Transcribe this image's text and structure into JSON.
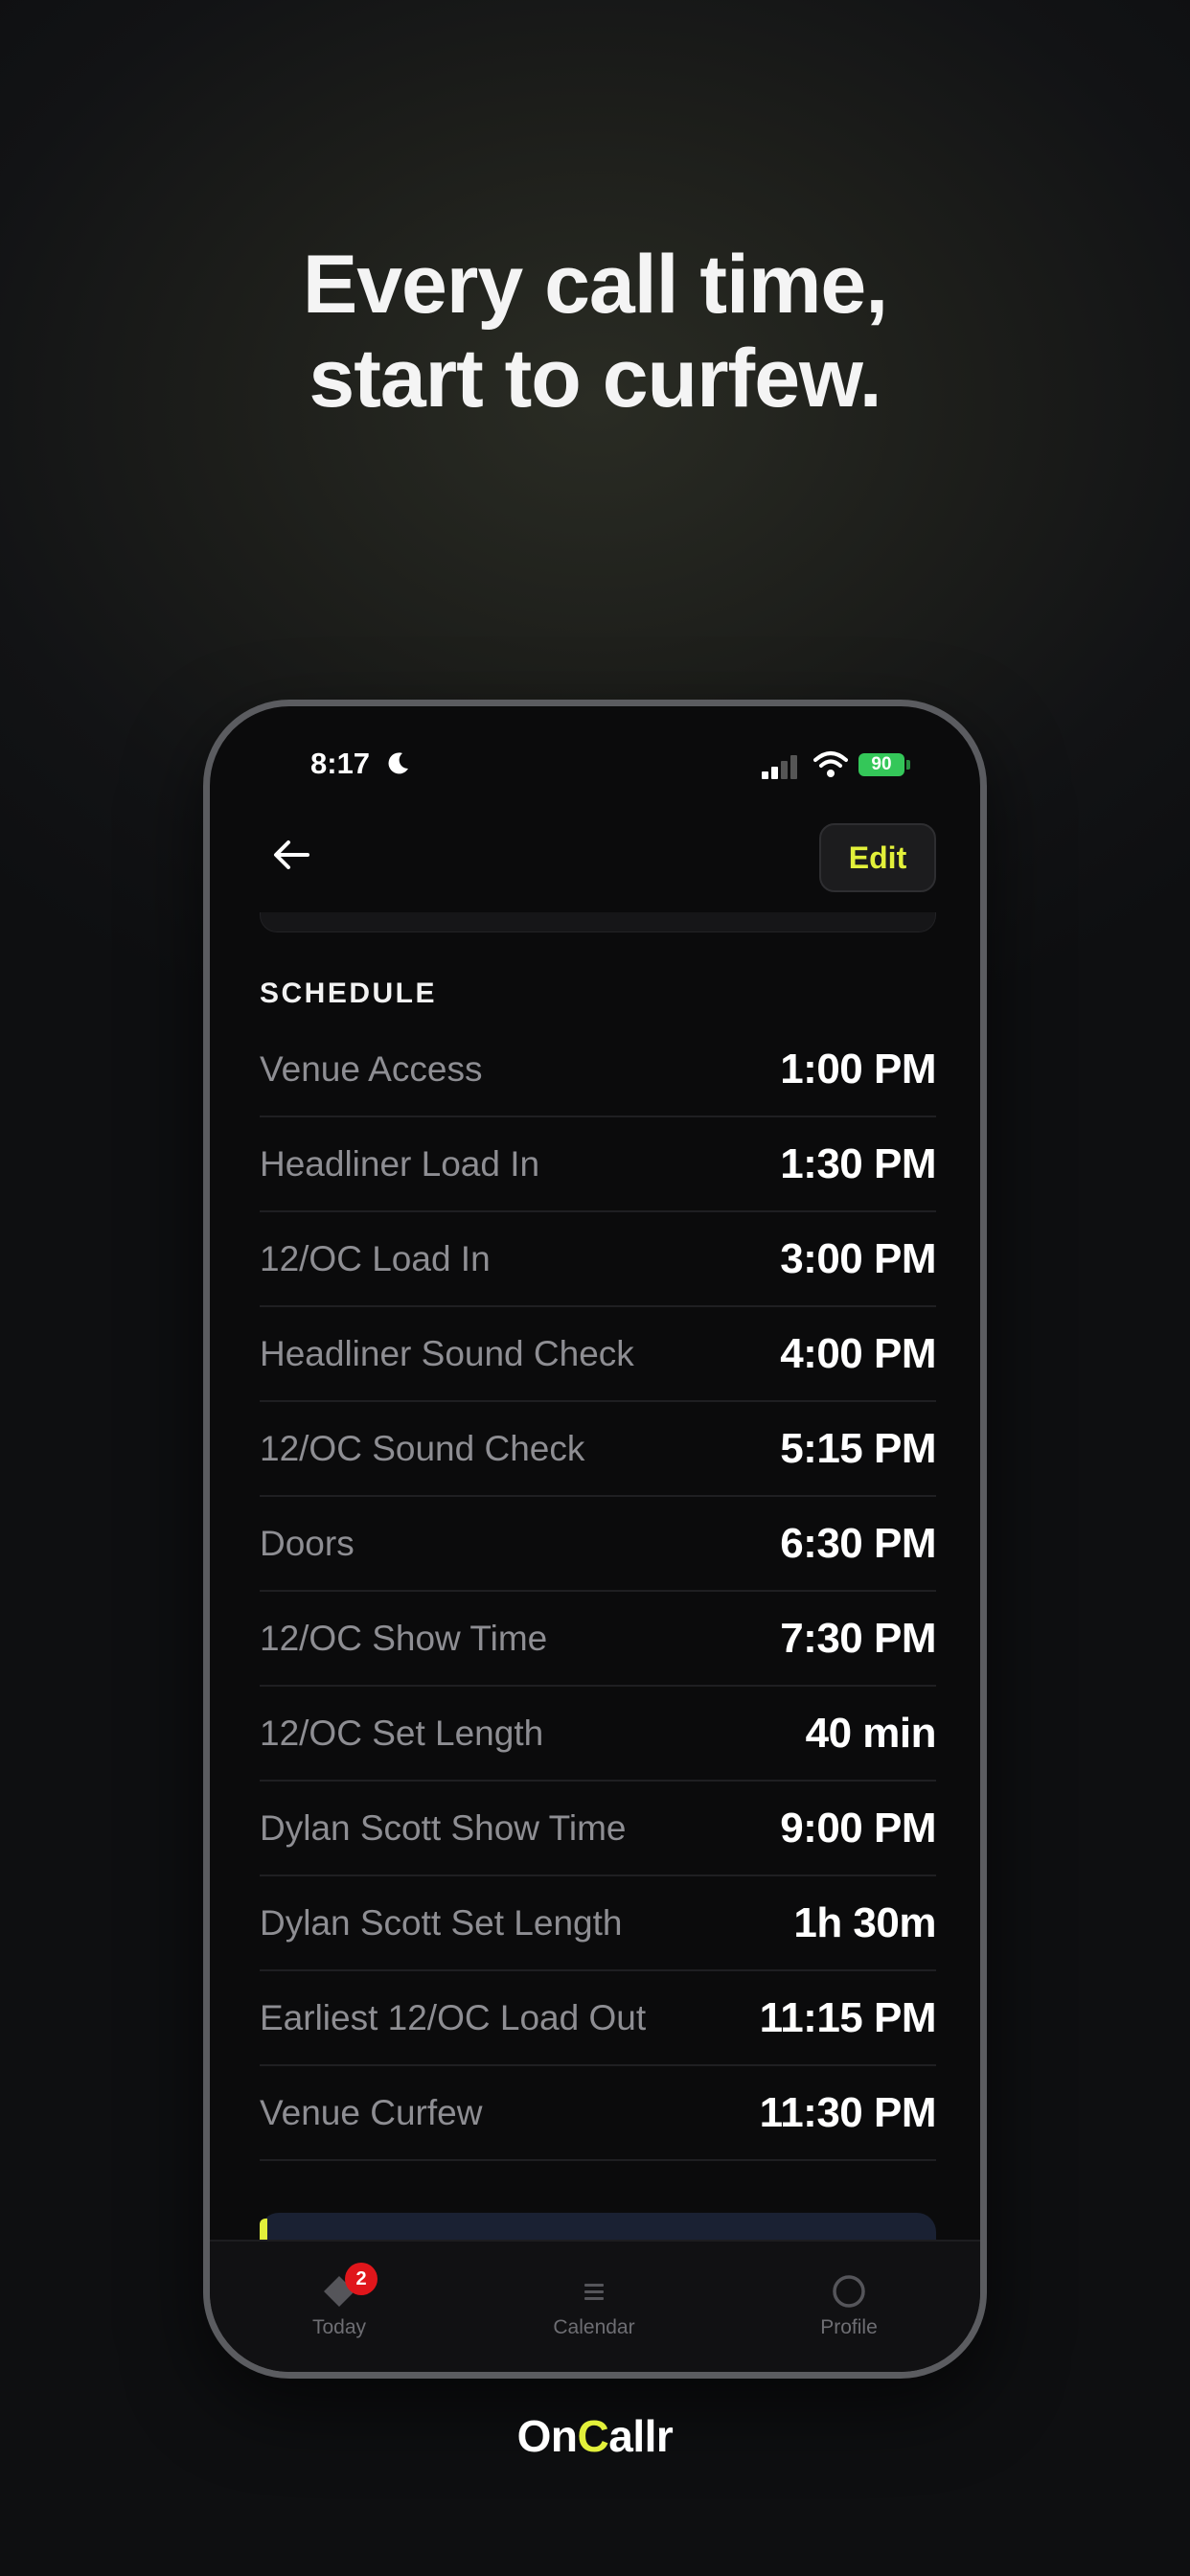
{
  "headline": {
    "line1": "Every call time,",
    "line2": "start to curfew."
  },
  "status_bar": {
    "time": "8:17",
    "battery": "90"
  },
  "nav": {
    "edit_label": "Edit"
  },
  "section_title": "SCHEDULE",
  "schedule": [
    {
      "label": "Venue Access",
      "value": "1:00 PM"
    },
    {
      "label": "Headliner Load In",
      "value": "1:30 PM"
    },
    {
      "label": "12/OC Load In",
      "value": "3:00 PM"
    },
    {
      "label": "Headliner Sound Check",
      "value": "4:00 PM"
    },
    {
      "label": "12/OC Sound Check",
      "value": "5:15 PM"
    },
    {
      "label": "Doors",
      "value": "6:30 PM"
    },
    {
      "label": "12/OC Show Time",
      "value": "7:30 PM"
    },
    {
      "label": "12/OC Set Length",
      "value": "40 min"
    },
    {
      "label": "Dylan Scott Show Time",
      "value": "9:00 PM"
    },
    {
      "label": "Dylan Scott Set Length",
      "value": "1h 30m"
    },
    {
      "label": "Earliest 12/OC Load Out",
      "value": "11:15 PM"
    },
    {
      "label": "Venue Curfew",
      "value": "11:30 PM"
    }
  ],
  "tabs": {
    "today": {
      "label": "Today",
      "badge": "2",
      "icon": "tag-icon"
    },
    "calendar": {
      "label": "Calendar",
      "icon": "list-icon"
    },
    "profile": {
      "label": "Profile",
      "icon": "circle-icon"
    }
  },
  "brand": {
    "part1": "On",
    "part2": "C",
    "part3": "allr"
  },
  "colors": {
    "accent": "#e2f03a",
    "badge": "#e0161b",
    "battery": "#34c759"
  }
}
